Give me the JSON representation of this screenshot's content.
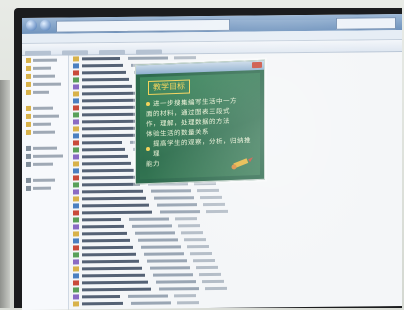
{
  "popup": {
    "heading": "教学目标",
    "lines": [
      "进一步搜集编写生活中一方",
      "面的材料，通过图表三段式",
      "作，理解，处理数据的方法",
      "体验生活的数量关系",
      "提高学生的观察，分析，归纳推理",
      "能力"
    ]
  },
  "colors": {
    "slide_bg": "#2e6f4e",
    "heading_color": "#f3d35a",
    "titlebar": "#6f93bd"
  }
}
